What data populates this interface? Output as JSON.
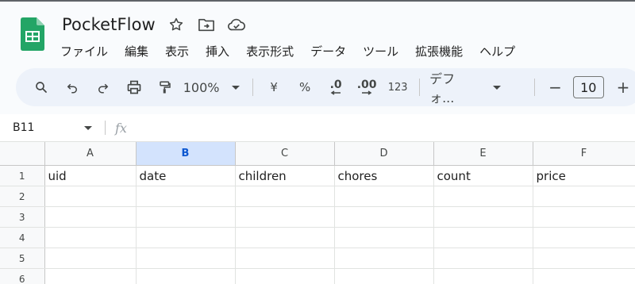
{
  "app": {
    "title": "PocketFlow"
  },
  "menu": [
    {
      "label": "ファイル"
    },
    {
      "label": "編集"
    },
    {
      "label": "表示"
    },
    {
      "label": "挿入"
    },
    {
      "label": "表示形式"
    },
    {
      "label": "データ"
    },
    {
      "label": "ツール"
    },
    {
      "label": "拡張機能"
    },
    {
      "label": "ヘルプ"
    }
  ],
  "toolbar": {
    "zoom": "100%",
    "currency": "¥",
    "percent": "%",
    "decrease_decimal": ".0",
    "increase_decimal": ".00",
    "number_format": "123",
    "font": "デフォ...",
    "decrease_size": "−",
    "font_size": "10",
    "increase_size": "+"
  },
  "formula_bar": {
    "name_box": "B11",
    "fx": "fx",
    "value": ""
  },
  "grid": {
    "columns": [
      "A",
      "B",
      "C",
      "D",
      "E",
      "F"
    ],
    "selected_column": "B",
    "rows": [
      {
        "num": "1",
        "cells": [
          "uid",
          "date",
          "children",
          "chores",
          "count",
          "price"
        ]
      },
      {
        "num": "2",
        "cells": [
          "",
          "",
          "",
          "",
          "",
          ""
        ]
      },
      {
        "num": "3",
        "cells": [
          "",
          "",
          "",
          "",
          "",
          ""
        ]
      },
      {
        "num": "4",
        "cells": [
          "",
          "",
          "",
          "",
          "",
          ""
        ]
      },
      {
        "num": "5",
        "cells": [
          "",
          "",
          "",
          "",
          "",
          ""
        ]
      },
      {
        "num": "6",
        "cells": [
          "",
          "",
          "",
          "",
          "",
          ""
        ]
      }
    ]
  },
  "colors": {
    "logo_green": "#23a566",
    "selected_header": "#d3e3fd",
    "toolbar_bg": "#edf2fa"
  }
}
